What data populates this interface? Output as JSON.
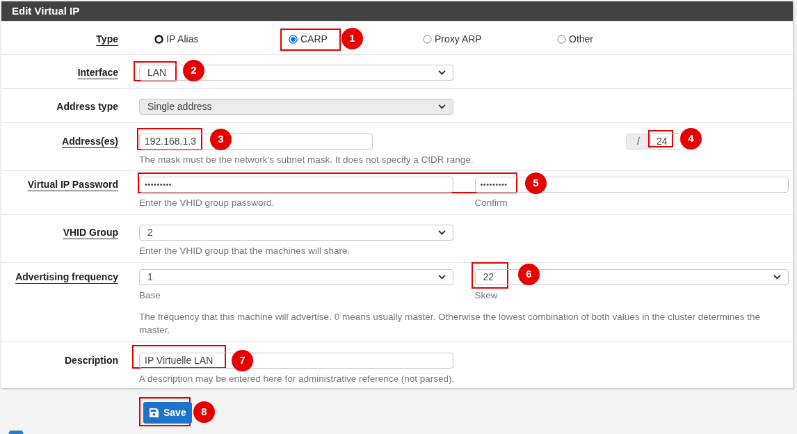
{
  "panel": {
    "title": "Edit Virtual IP"
  },
  "rows": [
    {
      "kind": "radio-group",
      "label": "Type",
      "underlined": true,
      "options": [
        {
          "label": "IP Alias",
          "selected": false,
          "focused": true
        },
        {
          "label": "CARP",
          "selected": true,
          "focused": false
        },
        {
          "label": "Proxy ARP",
          "selected": false,
          "focused": false
        },
        {
          "label": "Other",
          "selected": false,
          "focused": false
        }
      ]
    },
    {
      "kind": "select",
      "label": "Interface",
      "underlined": true,
      "value": "LAN",
      "disabled": false
    },
    {
      "kind": "select",
      "label": "Address type",
      "underlined": false,
      "value": "Single address",
      "disabled": true
    },
    {
      "kind": "address",
      "label": "Address(es)",
      "underlined": true,
      "value": "192.168.1.3",
      "separator": "/",
      "mask": "24",
      "hint": "The mask must be the network's subnet mask. It does not specify a CIDR range."
    },
    {
      "kind": "password-pair",
      "label": "Virtual IP Password",
      "underlined": true,
      "fields": [
        {
          "value": "•••••••••",
          "caption": "Enter the VHID group password."
        },
        {
          "value": "•••••••••",
          "caption": "Confirm"
        }
      ]
    },
    {
      "kind": "select",
      "label": "VHID Group",
      "underlined": true,
      "value": "2",
      "disabled": false,
      "hint": "Enter the VHID group that the machines will share."
    },
    {
      "kind": "select-pair",
      "label": "Advertising frequency",
      "underlined": true,
      "fields": [
        {
          "value": "1",
          "caption": "Base"
        },
        {
          "value": "22",
          "caption": "Skew"
        }
      ],
      "hint": "The frequency that this machine will advertise. 0 means usually master. Otherwise the lowest combination of both values in the cluster determines the master."
    },
    {
      "kind": "text-input",
      "label": "Description",
      "underlined": false,
      "value": "IP Virtuelle LAN",
      "hint": "A description may be entered here for administrative reference (not parsed)."
    }
  ],
  "save_button": {
    "label": "Save"
  },
  "callouts": [
    {
      "number": "1"
    },
    {
      "number": "2"
    },
    {
      "number": "3"
    },
    {
      "number": "4"
    },
    {
      "number": "5"
    },
    {
      "number": "6"
    },
    {
      "number": "7"
    },
    {
      "number": "8"
    }
  ]
}
